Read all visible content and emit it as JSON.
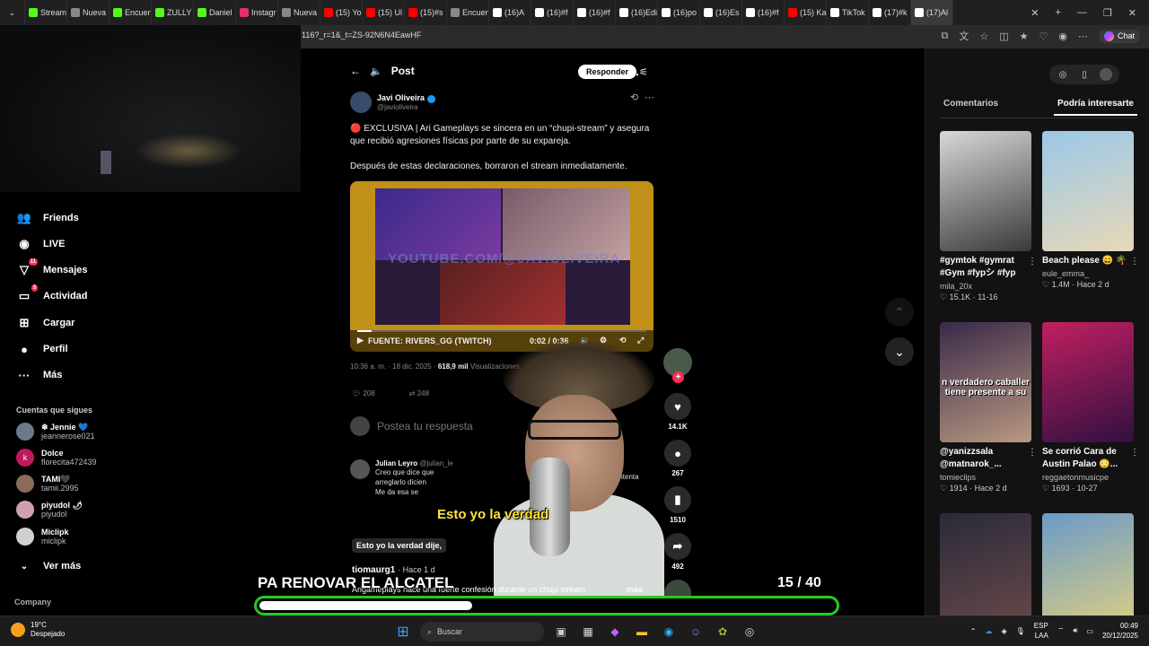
{
  "browser": {
    "tabs": [
      {
        "label": "Stream",
        "color": "#53fc18"
      },
      {
        "label": "Nueva",
        "color": "#888888"
      },
      {
        "label": "Encuen",
        "color": "#53fc18"
      },
      {
        "label": "ZULLY",
        "color": "#53fc18"
      },
      {
        "label": "Daniel",
        "color": "#53fc18"
      },
      {
        "label": "Instagr",
        "color": "#e1306c"
      },
      {
        "label": "Nueva",
        "color": "#888888"
      },
      {
        "label": "(15) Yo",
        "color": "#ff0000"
      },
      {
        "label": "(15) Ul",
        "color": "#ff0000"
      },
      {
        "label": "(15)#s",
        "color": "#ff0000"
      },
      {
        "label": "Encuen",
        "color": "#888888"
      },
      {
        "label": "(16)A",
        "color": "#ffffff"
      },
      {
        "label": "(16)#f",
        "color": "#ffffff"
      },
      {
        "label": "(16)#f",
        "color": "#ffffff"
      },
      {
        "label": "(16)Edi",
        "color": "#ffffff"
      },
      {
        "label": "(16)po",
        "color": "#ffffff"
      },
      {
        "label": "(16)Es",
        "color": "#ffffff"
      },
      {
        "label": "(16)#f",
        "color": "#ffffff"
      },
      {
        "label": "(15) Ka",
        "color": "#ff0000"
      },
      {
        "label": "TikTok",
        "color": "#ffffff"
      },
      {
        "label": "(17)#k",
        "color": "#ffffff"
      },
      {
        "label": "(17)Al",
        "color": "#ffffff"
      }
    ],
    "url": "116?_r=1&_t=ZS-92N6N4EawHF",
    "chat_label": "Chat"
  },
  "sidebar": {
    "nav": [
      {
        "label": "Friends",
        "icon": "friends-icon",
        "glyph": "👥",
        "badge": ""
      },
      {
        "label": "LIVE",
        "icon": "live-icon",
        "glyph": "◉",
        "badge": ""
      },
      {
        "label": "Mensajes",
        "icon": "messages-icon",
        "glyph": "▽",
        "badge": "11"
      },
      {
        "label": "Actividad",
        "icon": "activity-icon",
        "glyph": "▭",
        "badge": "3"
      },
      {
        "label": "Cargar",
        "icon": "upload-icon",
        "glyph": "⊞",
        "badge": ""
      },
      {
        "label": "Perfil",
        "icon": "profile-icon",
        "glyph": "●",
        "badge": ""
      },
      {
        "label": "Más",
        "icon": "more-icon",
        "glyph": "···",
        "badge": ""
      }
    ],
    "following_title": "Cuentas que sigues",
    "following": [
      {
        "name": "❄ Jennie 💙",
        "handle": "jeannerose021",
        "color": "#6a7a8a",
        "initial": ""
      },
      {
        "name": "Dolce",
        "handle": "florecita472439",
        "color": "#c0185a",
        "initial": "k"
      },
      {
        "name": "TAMI🖤",
        "handle": "tamii.2995",
        "color": "#8a6a5a",
        "initial": ""
      },
      {
        "name": "piyudol 🌶",
        "handle": "piyudol",
        "color": "#d0a0b0",
        "initial": ""
      },
      {
        "name": "Miclipk",
        "handle": "miclipk",
        "color": "#d0d0d0",
        "initial": ""
      }
    ],
    "see_more": "Ver más",
    "company": "Company"
  },
  "post": {
    "header": "Post",
    "reply_button": "Responder",
    "author_name": "Javi Oliveira",
    "author_handle": "@javioliveira",
    "text_line1": "🔴 EXCLUSIVA | Ari Gameplays se sincera en un “chupi-stream” y asegura que recibió agresiones físicas por parte de su expareja.",
    "text_line2": "Después de estas declaraciones, borraron el stream inmediatamente.",
    "video_watermark": "YOUTUBE.COM/@JAVIOLIVEIRA",
    "video_source": "FUENTE: RIVERS_GG (TWITCH)",
    "video_time": "0:02 / 0:36",
    "video_progress": 0.05,
    "timestamp": "10:36 a. m. · 18 dic. 2025 ·",
    "views": "618,9 mil",
    "views_label": "Visualizaciones",
    "replies": "208",
    "reposts": "248",
    "reply_placeholder": "Postea tu respuesta",
    "comment_name": "Julian Leyro",
    "comment_handle": "@julian_le",
    "comment_lines": [
      "Creo que dice que",
      "arreglarlo dicien",
      "Me da esa se"
    ],
    "comment_right": "ego intenta"
  },
  "overlay": {
    "caption_big": "Esto yo la verdad",
    "caption_small": "Esto yo la verdad dije,",
    "username": "tiomaurg1",
    "user_time": "· Hace 1 d",
    "description": "Arigameplays hace una fuerte confesión durante un chupi stream",
    "more": "más",
    "bottom_title": "PA RENOVAR EL ALCATEL",
    "counter": "15  / 40",
    "progress": 0.37
  },
  "rail": {
    "likes": "14.1K",
    "comments": "267",
    "saves": "1510",
    "shares": "492"
  },
  "right_panel": {
    "tab_comments": "Comentarios",
    "tab_interesting": "Podría interesarte",
    "cards": [
      {
        "title": "#gymtok #gymrat #Gym #fypシ #fyp",
        "user": "mila_20x",
        "likes": "15.1K",
        "date": "11-16",
        "c1": "#d8d8d8",
        "c2": "#3a3a3a"
      },
      {
        "title": "Beach please 😄 🌴",
        "user": "eule_emma_",
        "likes": "1.4M",
        "date": "Hace 2 d",
        "c1": "#9ac8e8",
        "c2": "#e8d8b8"
      },
      {
        "title": "@yanizzsala @matnarok_...",
        "user": "tomieclips",
        "likes": "1914",
        "date": "Hace 2 d",
        "c1": "#3a2a4a",
        "c2": "#b89880",
        "text": "n verdadero caballer tiene presente a su"
      },
      {
        "title": "Se corrió Cara de Austin Palao 😳...",
        "user": "reggaetonmusicpe",
        "likes": "1693",
        "date": "10-27",
        "c1": "#c02060",
        "c2": "#301040"
      },
      {
        "title": "",
        "user": "",
        "likes": "",
        "date": "",
        "c1": "#2a2a3a",
        "c2": "#6a4a4a"
      },
      {
        "title": "",
        "user": "",
        "likes": "",
        "date": "",
        "c1": "#6a9ac8",
        "c2": "#e0d080"
      }
    ]
  },
  "taskbar": {
    "temp": "19°C",
    "weather": "Despejado",
    "search": "Buscar",
    "lang1": "ESP",
    "lang2": "LAA",
    "time": "00:49",
    "date": "20/12/2025"
  }
}
